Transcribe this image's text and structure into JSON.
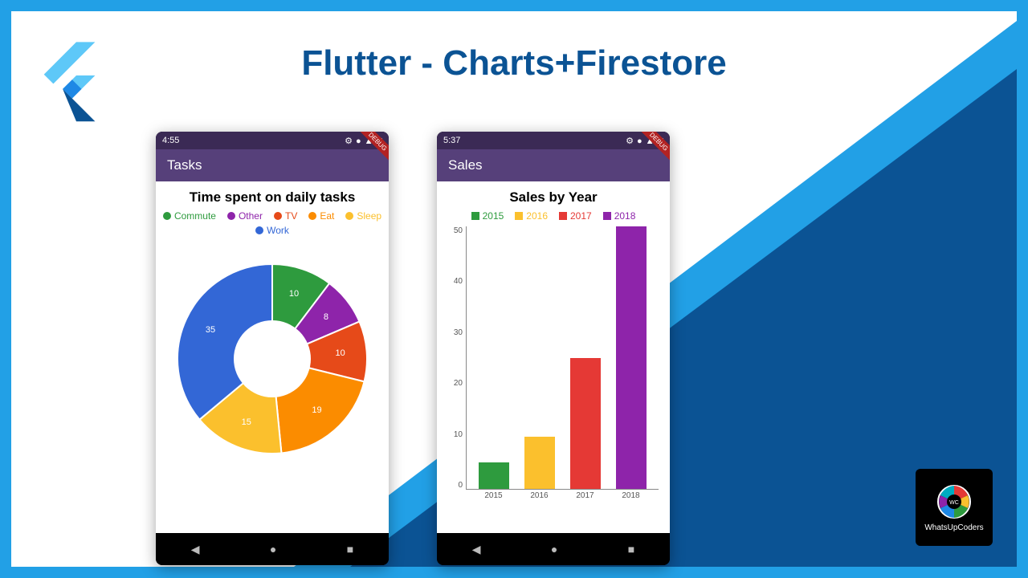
{
  "slide": {
    "title": "Flutter - Charts+Firestore"
  },
  "phone1": {
    "status_time": "4:55",
    "appbar_title": "Tasks",
    "chart_title": "Time spent on daily tasks",
    "debug_label": "DEBUG"
  },
  "phone2": {
    "status_time": "5:37",
    "appbar_title": "Sales",
    "chart_title": "Sales by Year",
    "debug_label": "DEBUG"
  },
  "badge": {
    "label": "WhatsUpCoders",
    "initials": "WC"
  },
  "chart_data": [
    {
      "type": "pie",
      "title": "Time spent on daily tasks",
      "series": [
        {
          "name": "Commute",
          "value": 10,
          "color": "#2e9b3e"
        },
        {
          "name": "Other",
          "value": 8,
          "color": "#8e24aa"
        },
        {
          "name": "TV",
          "value": 10,
          "color": "#e64a19"
        },
        {
          "name": "Eat",
          "value": 19,
          "color": "#fb8c00"
        },
        {
          "name": "Sleep",
          "value": 15,
          "color": "#fbc02d"
        },
        {
          "name": "Work",
          "value": 35,
          "color": "#3367d6"
        }
      ],
      "legend_order": [
        "Commute",
        "Other",
        "TV",
        "Eat",
        "Sleep",
        "Work"
      ],
      "hole": true
    },
    {
      "type": "bar",
      "title": "Sales by Year",
      "categories": [
        "2015",
        "2016",
        "2017",
        "2018"
      ],
      "values": [
        5,
        10,
        25,
        50
      ],
      "colors": [
        "#2e9b3e",
        "#fbc02d",
        "#e53935",
        "#8e24aa"
      ],
      "ylim": [
        0,
        50
      ],
      "yticks": [
        0,
        10,
        20,
        30,
        40,
        50
      ],
      "xlabel": "",
      "ylabel": ""
    }
  ]
}
